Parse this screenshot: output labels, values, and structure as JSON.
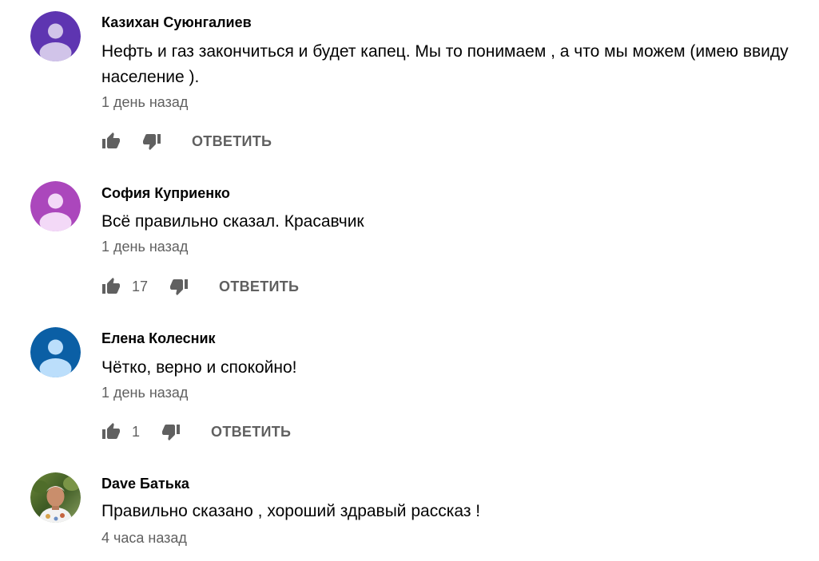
{
  "comments": [
    {
      "author": "Казихан Суюнгалиев",
      "text": "Нефть и газ закончиться и будет капец. Мы то понимаем , а что мы можем  (имею ввиду население ).",
      "time": "1 день назад",
      "likes": "",
      "reply_label": "ОТВЕТИТЬ",
      "avatar_bg": "#5e35b1",
      "avatar_fg": "#d1c4e9"
    },
    {
      "author": "София Куприенко",
      "text": "Всё правильно сказал. Красавчик",
      "time": "1 день назад",
      "likes": "17",
      "reply_label": "ОТВЕТИТЬ",
      "avatar_bg": "#ab47bc",
      "avatar_fg": "#f3d9f7"
    },
    {
      "author": "Елена Колесник",
      "text": "Чётко, верно и спокойно!",
      "time": "1 день назад",
      "likes": "1",
      "reply_label": "ОТВЕТИТЬ",
      "avatar_bg": "#0b5fa5",
      "avatar_fg": "#bbdefb"
    },
    {
      "author": "Dave Батька",
      "text": "Правильно сказано , хороший здравый рассказ !",
      "time": "4 часа назад"
    }
  ],
  "icons": {
    "like": "thumbs-up-icon",
    "dislike": "thumbs-down-icon",
    "avatar_default": "person-icon",
    "avatar_photo": "user-photo"
  },
  "colors": {
    "text_primary": "#030303",
    "text_secondary": "#606060"
  }
}
